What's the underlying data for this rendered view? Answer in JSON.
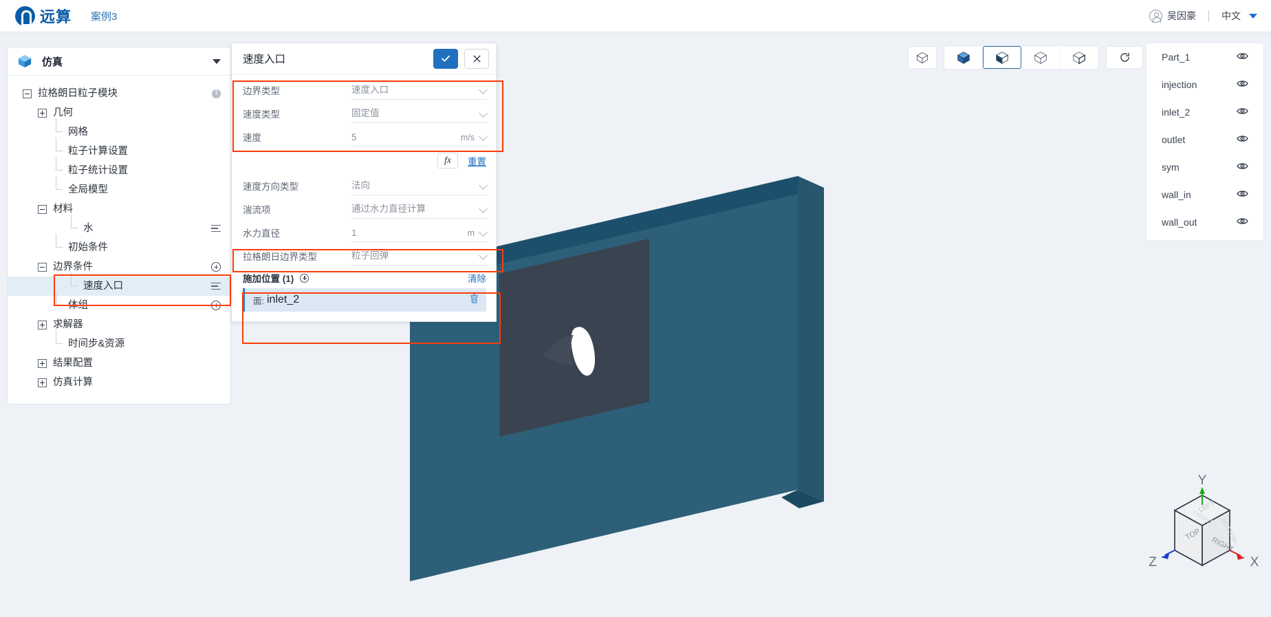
{
  "header": {
    "brand": "远算",
    "case_name": "案例3",
    "user_name": "吴因豪",
    "language": "中文",
    "user_icon": "user-circle-icon",
    "caret_icon": "caret-down-icon"
  },
  "sidebar": {
    "title": "仿真",
    "title_icon": "cube-icon",
    "collapse_icon": "caret-down-icon",
    "tree": [
      {
        "label": "拉格朗日粒子模块",
        "toggle": "minus",
        "depth": 0,
        "right": "info"
      },
      {
        "label": "几何",
        "toggle": "plus",
        "depth": 1
      },
      {
        "label": "网格",
        "toggle": "none",
        "depth": 2
      },
      {
        "label": "粒子计算设置",
        "toggle": "none",
        "depth": 2
      },
      {
        "label": "粒子统计设置",
        "toggle": "none",
        "depth": 2
      },
      {
        "label": "全局模型",
        "toggle": "none",
        "depth": 2
      },
      {
        "label": "材料",
        "toggle": "minus",
        "depth": 1
      },
      {
        "label": "水",
        "toggle": "none",
        "depth": 3,
        "right": "menu"
      },
      {
        "label": "初始条件",
        "toggle": "none",
        "depth": 2
      },
      {
        "label": "边界条件",
        "toggle": "minus",
        "depth": 1,
        "right": "plus"
      },
      {
        "label": "速度入口",
        "toggle": "none",
        "depth": 3,
        "right": "menu",
        "selected": true
      },
      {
        "label": "体组",
        "toggle": "none",
        "depth": 2,
        "right": "plus"
      },
      {
        "label": "求解器",
        "toggle": "plus",
        "depth": 1
      },
      {
        "label": "时间步&资源",
        "toggle": "none",
        "depth": 2
      },
      {
        "label": "结果配置",
        "toggle": "plus",
        "depth": 1
      },
      {
        "label": "仿真计算",
        "toggle": "plus",
        "depth": 1
      }
    ]
  },
  "panel": {
    "title": "速度入口",
    "ok_icon": "check-icon",
    "cancel_icon": "close-icon",
    "fields_top": [
      {
        "label": "边界类型",
        "value": "速度入口",
        "unit": "",
        "control": "select"
      },
      {
        "label": "速度类型",
        "value": "固定值",
        "unit": "",
        "control": "select"
      },
      {
        "label": "速度",
        "value": "5",
        "unit": "m/s",
        "control": "input-unit"
      }
    ],
    "fx_label": "fx",
    "reset_label": "重置",
    "fields_mid": [
      {
        "label": "速度方向类型",
        "value": "法向",
        "unit": "",
        "control": "select"
      },
      {
        "label": "湍流项",
        "value": "通过水力直径计算",
        "unit": "",
        "control": "select"
      },
      {
        "label": "水力直径",
        "value": "1",
        "unit": "m",
        "control": "input-unit"
      }
    ],
    "fields_bottom": [
      {
        "label": "拉格朗日边界类型",
        "value": "粒子回弹",
        "unit": "",
        "control": "select"
      }
    ],
    "apply": {
      "title": "施加位置 (1)",
      "add_icon": "plus-circle-icon",
      "clear_label": "清除",
      "items": [
        {
          "prefix": "面:",
          "name": "inlet_2",
          "delete_icon": "trash-icon"
        }
      ]
    }
  },
  "viewport_toolbar": {
    "items": [
      {
        "name": "wireframe-cube-icon",
        "state": "plain",
        "group": "single"
      },
      {
        "name": "shaded-cube-icon",
        "state": "filled",
        "group": "multi"
      },
      {
        "name": "shaded-edges-cube-icon",
        "state": "half",
        "group": "multi",
        "active": true
      },
      {
        "name": "outline-cube-icon",
        "state": "outline",
        "group": "multi"
      },
      {
        "name": "edges-cube-icon",
        "state": "edges",
        "group": "multi"
      },
      {
        "name": "reset-view-icon",
        "state": "refresh",
        "group": "single"
      }
    ]
  },
  "parts_panel": {
    "items": [
      {
        "label": "Part_1",
        "visibility_icon": "eye-icon"
      },
      {
        "label": "injection",
        "visibility_icon": "eye-icon"
      },
      {
        "label": "inlet_2",
        "visibility_icon": "eye-icon"
      },
      {
        "label": "outlet",
        "visibility_icon": "eye-icon"
      },
      {
        "label": "sym",
        "visibility_icon": "eye-icon"
      },
      {
        "label": "wall_in",
        "visibility_icon": "eye-icon"
      },
      {
        "label": "wall_out",
        "visibility_icon": "eye-icon"
      }
    ]
  },
  "axis_gizmo": {
    "x_label": "X",
    "y_label": "Y",
    "z_label": "Z",
    "faces": {
      "top": "TOP",
      "right": "RIGHT",
      "left": "LEFT",
      "front": "FRONT",
      "bottom": "BOTTOM"
    },
    "x_color": "#e02020",
    "y_color": "#18a818",
    "z_color": "#1a3fd0"
  },
  "colors": {
    "accent": "#2070bf",
    "annotation": "#fa3c0a",
    "geometry_body": "#2d5f78",
    "geometry_dark": "#3a4450",
    "canvas_bg": "#eef1f5"
  }
}
